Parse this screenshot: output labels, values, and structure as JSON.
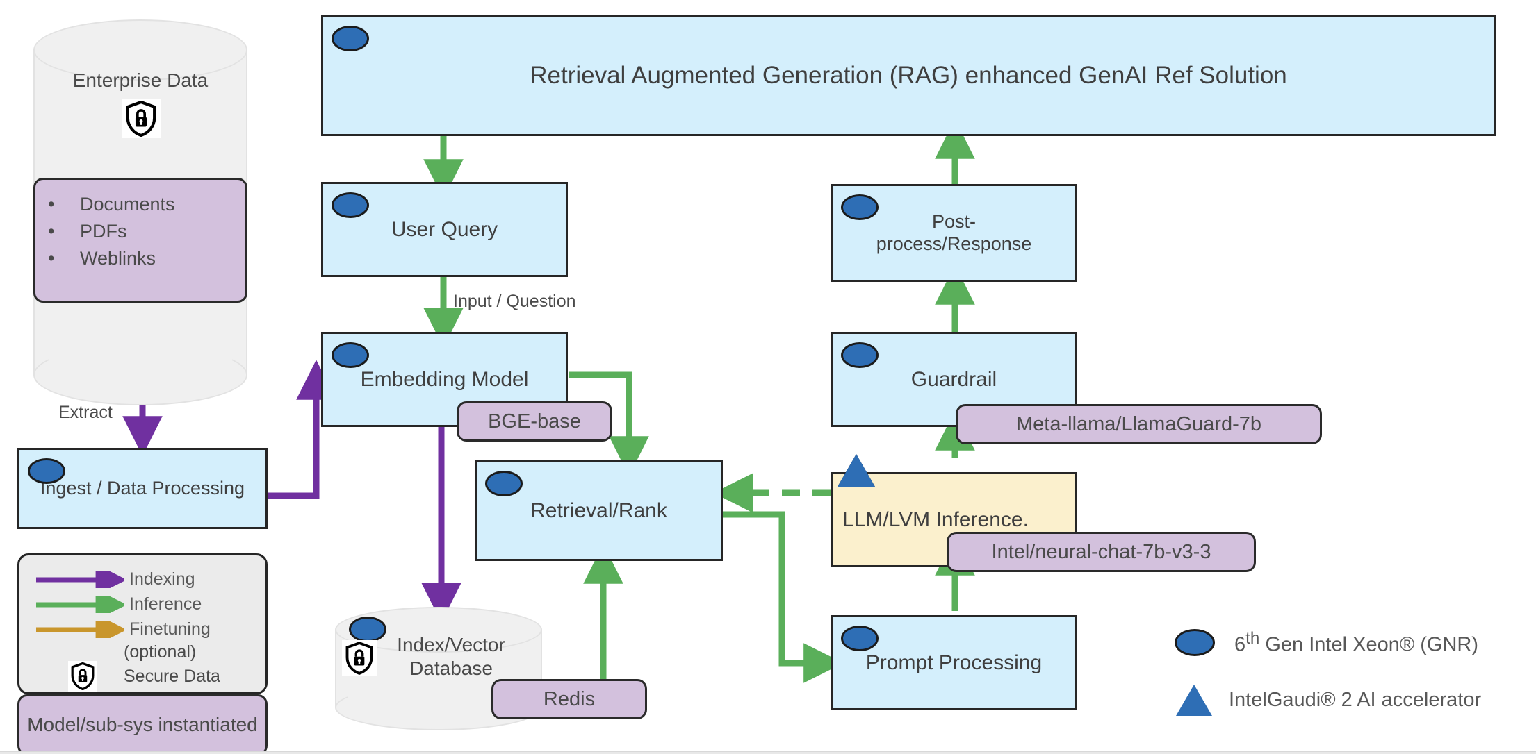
{
  "diagram": {
    "title_banner": "Retrieval Augmented Generation (RAG) enhanced GenAI Ref Solution",
    "nodes": {
      "enterprise_data": "Enterprise Data",
      "data_types": [
        "Documents",
        "PDFs",
        "Weblinks"
      ],
      "ingest": "Ingest / Data Processing",
      "user_query": "User Query",
      "embedding_model": "Embedding Model",
      "retrieval_rank": "Retrieval/Rank",
      "index_vector_db": "Index/Vector Database",
      "post_process": "Post-process/Response",
      "guardrail": "Guardrail",
      "llm_inference": "LLM/LVM Inference.",
      "prompt_processing": "Prompt Processing"
    },
    "model_pills": {
      "embedding": "BGE-base",
      "vector_db": "Redis",
      "guardrail": "Meta-llama/LlamaGuard-7b",
      "llm": "Intel/neural-chat-7b-v3-3"
    },
    "edge_labels": {
      "extract": "Extract",
      "input_question": "Input / Question"
    },
    "legend": {
      "flows": [
        {
          "label": "Indexing",
          "color": "#7030a0"
        },
        {
          "label": "Inference",
          "color": "#5aaf5a"
        },
        {
          "label": "Finetuning",
          "color": "#c9962c"
        }
      ],
      "optional_note": "(optional)",
      "secure_data": "Secure Data",
      "model_instantiated": "Model/sub-sys instantiated"
    },
    "hw_legend": [
      {
        "icon": "ellipse-icon",
        "label_html": "6<sup>th</sup> Gen Intel Xeon® (GNR)"
      },
      {
        "icon": "triangle-icon",
        "label_html": "IntelGaudi® 2 AI accelerator"
      }
    ],
    "colors": {
      "box_fill": "#d4effc",
      "box_border": "#262626",
      "tan_fill": "#fbf0cd",
      "pill_fill": "#d3c1dd",
      "cylinder_fill": "#f0f0f0",
      "xeon_blue": "#2e6eb5",
      "indexing_purple": "#7030a0",
      "inference_green": "#5aaf5a",
      "finetuning_gold": "#c9962c",
      "text_gray": "#4a4a4a"
    }
  }
}
